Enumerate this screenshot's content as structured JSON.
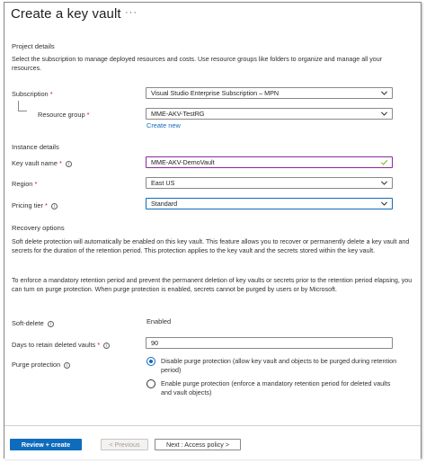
{
  "title": "Create a key vault",
  "more_icon": "ellipsis-icon",
  "project": {
    "heading": "Project details",
    "description": "Select the subscription to manage deployed resources and costs. Use resource groups like folders to organize and manage all your resources.",
    "subscription_label": "Subscription",
    "subscription_value": "Visual Studio Enterprise Subscription – MPN",
    "rg_label": "Resource group",
    "rg_value": "MME-AKV-TestRG",
    "create_new": "Create new"
  },
  "instance": {
    "heading": "Instance details",
    "name_label": "Key vault name",
    "name_value": "MME-AKV-DemoVault",
    "region_label": "Region",
    "region_value": "East US",
    "tier_label": "Pricing tier",
    "tier_value": "Standard"
  },
  "recovery": {
    "heading": "Recovery options",
    "para1": "Soft delete protection will automatically be enabled on this key vault. This feature allows you to recover or permanently delete a key vault and secrets for the duration of the retention period. This protection applies to the key vault and the secrets stored within the key vault.",
    "para2": "To enforce a mandatory retention period and prevent the permanent deletion of key vaults or secrets prior to the retention period elapsing, you can turn on purge protection. When purge protection is enabled, secrets cannot be purged by users or by Microsoft.",
    "soft_delete_label": "Soft-delete",
    "soft_delete_value": "Enabled",
    "days_label": "Days to retain deleted vaults",
    "days_value": "90",
    "purge_label": "Purge protection",
    "purge_options": [
      {
        "label": "Disable purge protection (allow key vault and objects to be purged during retention period)",
        "selected": true
      },
      {
        "label": "Enable purge protection (enforce a mandatory retention period for deleted vaults and vault objects)",
        "selected": false
      }
    ]
  },
  "footer": {
    "review_create": "Review + create",
    "previous": "< Previous",
    "next": "Next : Access policy >"
  },
  "colors": {
    "accent": "#0f6cbd",
    "required": "#a4262c",
    "valid_border": "#8a2a9f",
    "valid_check": "#6bb700"
  }
}
